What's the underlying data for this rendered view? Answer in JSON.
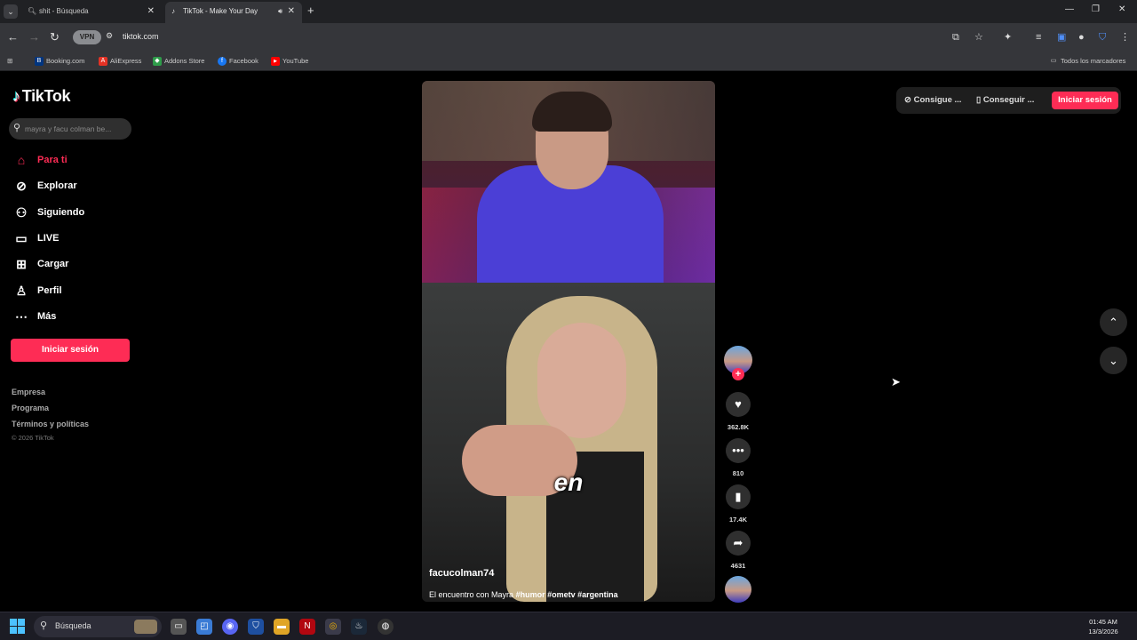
{
  "browser": {
    "tabs": [
      {
        "title": "shit - Búsqueda",
        "active": false
      },
      {
        "title": "TikTok - Make Your Day",
        "active": true
      }
    ],
    "url": "tiktok.com",
    "vpn_label": "VPN",
    "bookmarks": [
      {
        "label": "Booking.com",
        "color": "#003580",
        "glyph": "B"
      },
      {
        "label": "AliExpress",
        "color": "#e43225",
        "glyph": "A"
      },
      {
        "label": "Addons Store",
        "color": "#2e9c4a",
        "glyph": "◆"
      },
      {
        "label": "Facebook",
        "color": "#1877f2",
        "glyph": "f"
      },
      {
        "label": "YouTube",
        "color": "#ff0000",
        "glyph": "▶"
      }
    ],
    "all_bookmarks": "Todos los marcadores"
  },
  "tiktok": {
    "logo_text": "TikTok",
    "search_placeholder": "mayra y facu colman be...",
    "nav": [
      {
        "label": "Para ti",
        "icon": "home-icon",
        "active": true
      },
      {
        "label": "Explorar",
        "icon": "compass-icon",
        "active": false
      },
      {
        "label": "Siguiendo",
        "icon": "following-icon",
        "active": false
      },
      {
        "label": "LIVE",
        "icon": "live-icon",
        "active": false
      },
      {
        "label": "Cargar",
        "icon": "upload-icon",
        "active": false
      },
      {
        "label": "Perfil",
        "icon": "profile-icon",
        "active": false
      },
      {
        "label": "Más",
        "icon": "more-icon",
        "active": false
      }
    ],
    "login_button": "Iniciar sesión",
    "footer": [
      "Empresa",
      "Programa",
      "Términos y políticas"
    ],
    "copyright": "© 2026 TikTok",
    "top_right": {
      "get_app_1": "Consigue ...",
      "get_app_2": "Conseguir ...",
      "login": "Iniciar sesión"
    },
    "video": {
      "caption_word": "en",
      "username": "facucolman74",
      "description": "El encuentro con Mayra",
      "hashtags": "#humor #ometv #argentina",
      "progress": 0.75
    },
    "actions": {
      "likes": "362.8K",
      "comments": "810",
      "saves": "17.4K",
      "shares": "4631"
    }
  },
  "taskbar": {
    "search_label": "Búsqueda",
    "time": "01:45 AM",
    "date": "13/3/2026"
  }
}
